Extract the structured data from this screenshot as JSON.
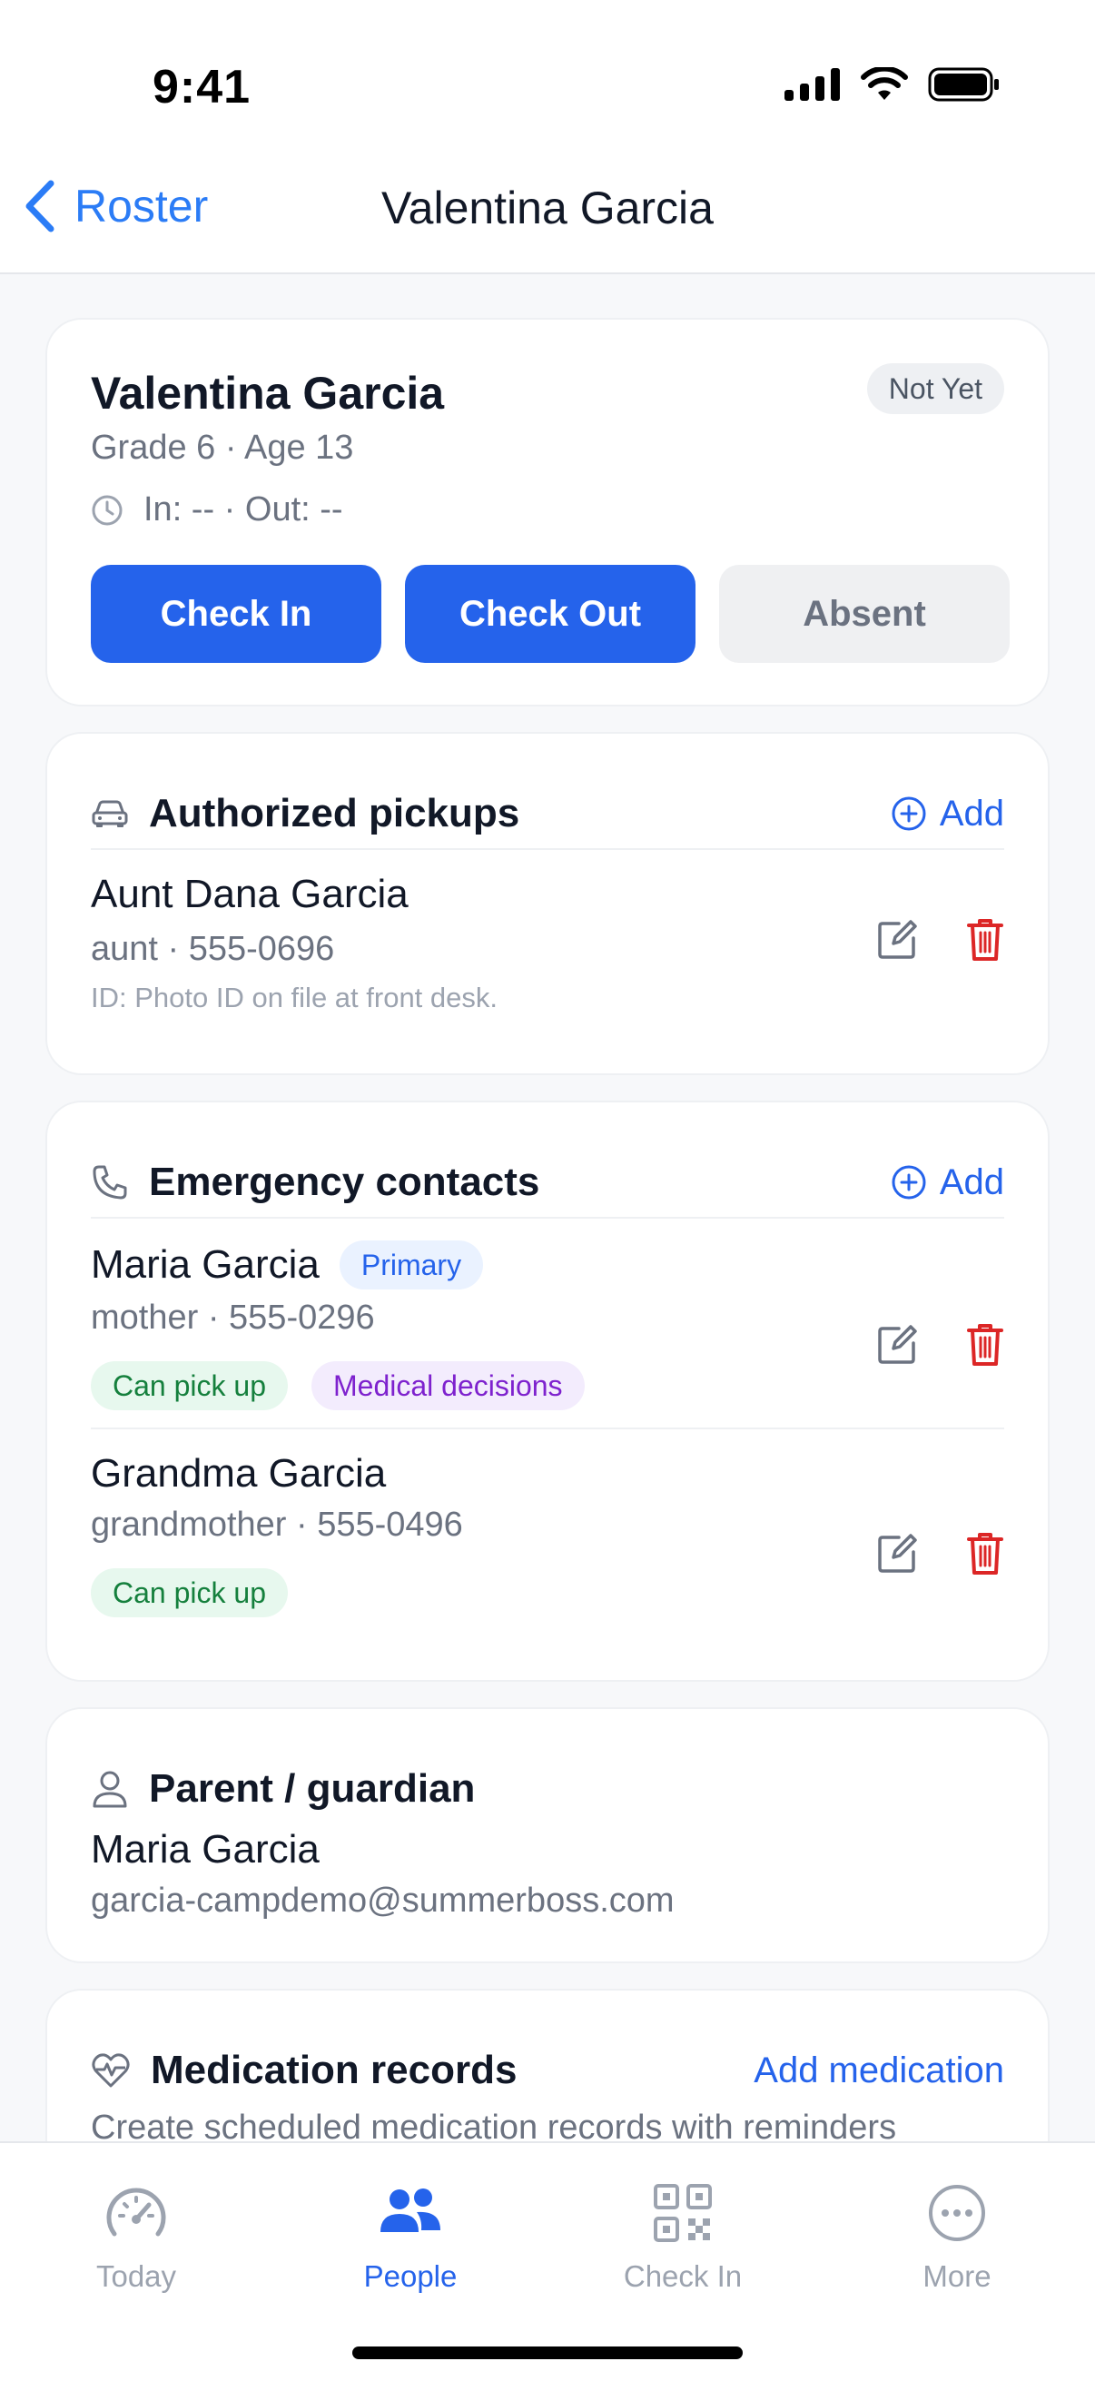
{
  "status_bar": {
    "time": "9:41"
  },
  "nav": {
    "back_label": "Roster",
    "title": "Valentina Garcia"
  },
  "student": {
    "name": "Valentina Garcia",
    "meta": "Grade 6 · Age 13",
    "times": "In: -- · Out: --",
    "status": "Not Yet",
    "buttons": {
      "check_in": "Check In",
      "check_out": "Check Out",
      "absent": "Absent"
    }
  },
  "pickups": {
    "title": "Authorized pickups",
    "add_label": "Add",
    "items": [
      {
        "name": "Aunt Dana Garcia",
        "sub": "aunt · 555-0696",
        "note": "ID: Photo ID on file at front desk."
      }
    ]
  },
  "emergency": {
    "title": "Emergency contacts",
    "add_label": "Add",
    "items": [
      {
        "name": "Maria Garcia",
        "badge": "Primary",
        "sub": "mother · 555-0296",
        "tags": [
          "Can pick up",
          "Medical decisions"
        ]
      },
      {
        "name": "Grandma Garcia",
        "sub": "grandmother · 555-0496",
        "tags": [
          "Can pick up"
        ]
      }
    ]
  },
  "guardian": {
    "title": "Parent / guardian",
    "name": "Maria Garcia",
    "email": "garcia-campdemo@summerboss.com"
  },
  "medication": {
    "title": "Medication records",
    "add_label": "Add medication",
    "description": "Create scheduled medication records with reminders"
  },
  "tabbar": {
    "tabs": [
      {
        "label": "Today",
        "icon": "gauge-icon"
      },
      {
        "label": "People",
        "icon": "people-icon",
        "active": true
      },
      {
        "label": "Check In",
        "icon": "qr-code-icon"
      },
      {
        "label": "More",
        "icon": "more-icon"
      }
    ]
  },
  "colors": {
    "accent": "#2563eb",
    "danger": "#dc2626",
    "success": "#15803d",
    "purple": "#7e22ce"
  }
}
